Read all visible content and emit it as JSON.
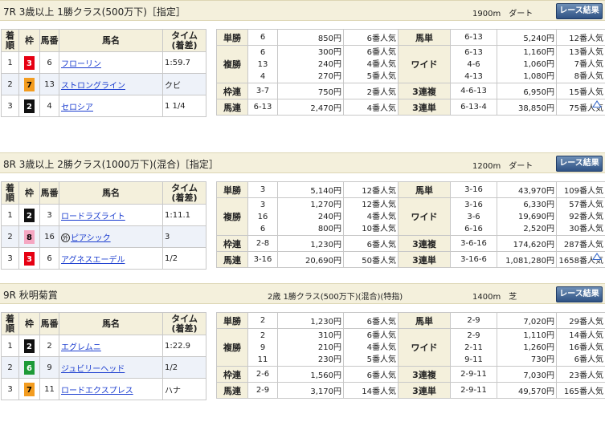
{
  "button_label": "レース結果",
  "colors": {
    "header_bg": "#f4f0dc",
    "button": "#2f5284",
    "link": "#1a3ccf",
    "alt_row": "#eef2f9",
    "up_icon": "#3a6bc9"
  },
  "icons": [
    "up-arrow-icon"
  ],
  "results_header": {
    "order": "着順",
    "waku": "枠",
    "umaban": "馬番",
    "horse": "馬名",
    "time": "タイム\n(着差)"
  },
  "payout_labels": {
    "win": "単勝",
    "place": "複勝",
    "bracket": "枠連",
    "quinella": "馬連",
    "exacta": "馬単",
    "wide": "ワイド",
    "trio": "3連複",
    "trifecta": "3連単"
  },
  "races": [
    {
      "title": "7R 3歳以上 1勝クラス(500万下)［指定］",
      "conditions": "",
      "distance": "1900m　ダート",
      "results": [
        {
          "order": "1",
          "waku": "3",
          "umaban": "6",
          "horse": "フローリン",
          "time": "1:59.7",
          "mark": ""
        },
        {
          "order": "2",
          "waku": "7",
          "umaban": "13",
          "horse": "ストロングライン",
          "time": "クビ",
          "mark": ""
        },
        {
          "order": "3",
          "waku": "2",
          "umaban": "4",
          "horse": "セロシア",
          "time": "1 1/4",
          "mark": ""
        }
      ],
      "payouts": {
        "win": {
          "num": "6",
          "amt": "850円",
          "pop": "6番人気"
        },
        "place": [
          {
            "num": "6",
            "amt": "300円",
            "pop": "6番人気"
          },
          {
            "num": "13",
            "amt": "240円",
            "pop": "4番人気"
          },
          {
            "num": "4",
            "amt": "270円",
            "pop": "5番人気"
          }
        ],
        "bracket": {
          "num": "3-7",
          "amt": "750円",
          "pop": "2番人気"
        },
        "quinella": {
          "num": "6-13",
          "amt": "2,470円",
          "pop": "4番人気"
        },
        "exacta": {
          "num": "6-13",
          "amt": "5,240円",
          "pop": "12番人気"
        },
        "wide": [
          {
            "num": "6-13",
            "amt": "1,160円",
            "pop": "13番人気"
          },
          {
            "num": "4-6",
            "amt": "1,060円",
            "pop": "7番人気"
          },
          {
            "num": "4-13",
            "amt": "1,080円",
            "pop": "8番人気"
          }
        ],
        "trio": {
          "num": "4-6-13",
          "amt": "6,950円",
          "pop": "15番人気"
        },
        "trifecta": {
          "num": "6-13-4",
          "amt": "38,850円",
          "pop": "75番人気"
        }
      }
    },
    {
      "title": "8R 3歳以上 2勝クラス(1000万下)(混合)［指定］",
      "conditions": "",
      "distance": "1200m　ダート",
      "results": [
        {
          "order": "1",
          "waku": "2",
          "umaban": "3",
          "horse": "ロードラズライト",
          "time": "1:11.1",
          "mark": ""
        },
        {
          "order": "2",
          "waku": "8",
          "umaban": "16",
          "horse": "ピアシック",
          "time": "3",
          "mark": "外"
        },
        {
          "order": "3",
          "waku": "3",
          "umaban": "6",
          "horse": "アグネスエーデル",
          "time": "1/2",
          "mark": ""
        }
      ],
      "payouts": {
        "win": {
          "num": "3",
          "amt": "5,140円",
          "pop": "12番人気"
        },
        "place": [
          {
            "num": "3",
            "amt": "1,270円",
            "pop": "12番人気"
          },
          {
            "num": "16",
            "amt": "240円",
            "pop": "4番人気"
          },
          {
            "num": "6",
            "amt": "800円",
            "pop": "10番人気"
          }
        ],
        "bracket": {
          "num": "2-8",
          "amt": "1,230円",
          "pop": "6番人気"
        },
        "quinella": {
          "num": "3-16",
          "amt": "20,690円",
          "pop": "50番人気"
        },
        "exacta": {
          "num": "3-16",
          "amt": "43,970円",
          "pop": "109番人気"
        },
        "wide": [
          {
            "num": "3-16",
            "amt": "6,330円",
            "pop": "57番人気"
          },
          {
            "num": "3-6",
            "amt": "19,690円",
            "pop": "92番人気"
          },
          {
            "num": "6-16",
            "amt": "2,520円",
            "pop": "30番人気"
          }
        ],
        "trio": {
          "num": "3-6-16",
          "amt": "174,620円",
          "pop": "287番人気"
        },
        "trifecta": {
          "num": "3-16-6",
          "amt": "1,081,280円",
          "pop": "1658番人気"
        }
      }
    },
    {
      "title": "9R 秋明菊賞",
      "conditions": "2歳 1勝クラス(500万下)(混合)(特指)",
      "distance": "1400m　芝",
      "results": [
        {
          "order": "1",
          "waku": "2",
          "umaban": "2",
          "horse": "エグレムニ",
          "time": "1:22.9",
          "mark": ""
        },
        {
          "order": "2",
          "waku": "6",
          "umaban": "9",
          "horse": "ジュビリーヘッド",
          "time": "1/2",
          "mark": ""
        },
        {
          "order": "3",
          "waku": "7",
          "umaban": "11",
          "horse": "ロードエクスプレス",
          "time": "ハナ",
          "mark": ""
        }
      ],
      "payouts": {
        "win": {
          "num": "2",
          "amt": "1,230円",
          "pop": "6番人気"
        },
        "place": [
          {
            "num": "2",
            "amt": "310円",
            "pop": "6番人気"
          },
          {
            "num": "9",
            "amt": "210円",
            "pop": "4番人気"
          },
          {
            "num": "11",
            "amt": "230円",
            "pop": "5番人気"
          }
        ],
        "bracket": {
          "num": "2-6",
          "amt": "1,560円",
          "pop": "6番人気"
        },
        "quinella": {
          "num": "2-9",
          "amt": "3,170円",
          "pop": "14番人気"
        },
        "exacta": {
          "num": "2-9",
          "amt": "7,020円",
          "pop": "29番人気"
        },
        "wide": [
          {
            "num": "2-9",
            "amt": "1,110円",
            "pop": "14番人気"
          },
          {
            "num": "2-11",
            "amt": "1,260円",
            "pop": "16番人気"
          },
          {
            "num": "9-11",
            "amt": "730円",
            "pop": "6番人気"
          }
        ],
        "trio": {
          "num": "2-9-11",
          "amt": "7,030円",
          "pop": "23番人気"
        },
        "trifecta": {
          "num": "2-9-11",
          "amt": "49,570円",
          "pop": "165番人気"
        }
      }
    }
  ]
}
